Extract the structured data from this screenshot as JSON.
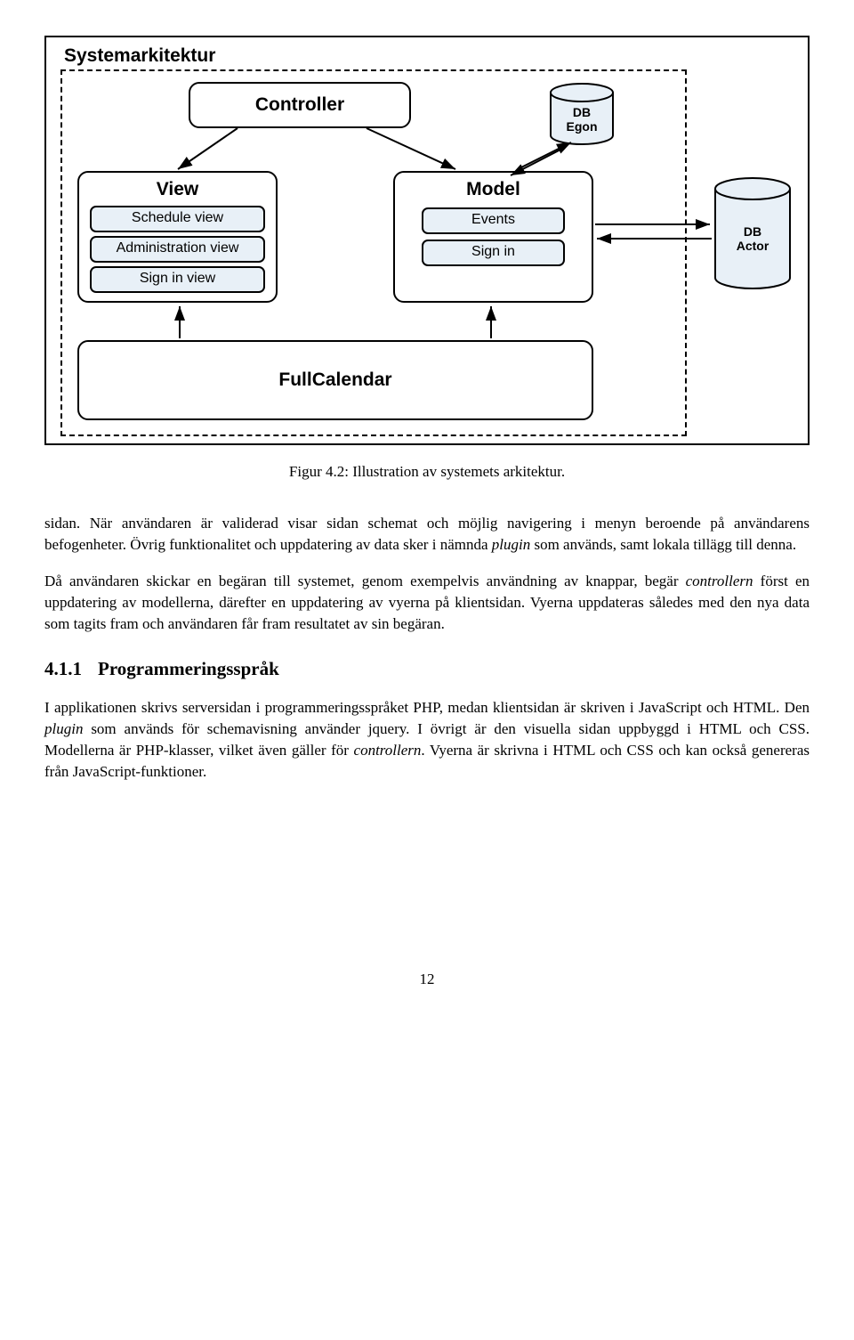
{
  "diagram": {
    "title": "Systemarkitektur",
    "controller": "Controller",
    "view": {
      "title": "View",
      "items": [
        "Schedule view",
        "Administration view",
        "Sign in view"
      ]
    },
    "model": {
      "title": "Model",
      "items": [
        "Events",
        "Sign in"
      ]
    },
    "fullcalendar": "FullCalendar",
    "db_egon": {
      "line1": "DB",
      "line2": "Egon"
    },
    "db_actor": {
      "line1": "DB",
      "line2": "Actor"
    }
  },
  "figure_caption": "Figur 4.2: Illustration av systemets arkitektur.",
  "paragraphs": {
    "p1_a": "sidan. När användaren är validerad visar sidan schemat och möjlig navigering i menyn beroende på användarens befogenheter. Övrig funktionalitet och uppdatering av data sker i nämnda ",
    "p1_b": " som används, samt lokala tillägg till denna.",
    "p2_a": "Då användaren skickar en begäran till systemet, genom exempelvis användning av knappar, begär ",
    "p2_b": " först en uppdatering av modellerna, därefter en uppdatering av vyerna på klientsidan. Vyerna uppdateras således med den nya data som tagits fram och användaren får fram resultatet av sin begäran.",
    "p3_a": "I applikationen skrivs serversidan i programmeringsspråket PHP, medan klientsidan är skriven i JavaScript och HTML. Den ",
    "p3_b": " som används för schemavisning använder jquery. I övrigt är den visuella sidan uppbyggd i HTML och CSS. Modellerna är PHP-klasser, vilket även gäller för ",
    "p3_c": ". Vyerna är skrivna i HTML och CSS och kan också genereras från JavaScript-funktioner."
  },
  "italic": {
    "plugin": "plugin",
    "controllern": "controllern"
  },
  "section": {
    "number": "4.1.1",
    "title": "Programmeringsspråk"
  },
  "page_number": "12"
}
